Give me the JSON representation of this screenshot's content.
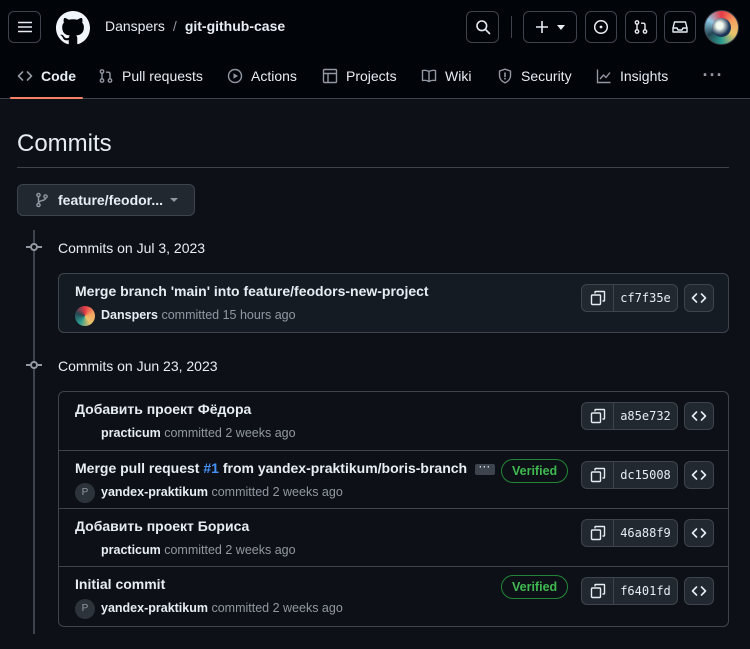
{
  "header": {
    "owner": "Danspers",
    "separator": "/",
    "repo": "git-github-case"
  },
  "nav": {
    "tabs": [
      {
        "label": "Code",
        "icon": "code-icon",
        "active": true
      },
      {
        "label": "Pull requests",
        "icon": "git-pull-request-icon"
      },
      {
        "label": "Actions",
        "icon": "play-icon"
      },
      {
        "label": "Projects",
        "icon": "table-icon"
      },
      {
        "label": "Wiki",
        "icon": "book-icon"
      },
      {
        "label": "Security",
        "icon": "shield-icon"
      },
      {
        "label": "Insights",
        "icon": "graph-icon"
      }
    ],
    "more": "···"
  },
  "page": {
    "title": "Commits",
    "branch": "feature/feodor..."
  },
  "groups": [
    {
      "title": "Commits on Jul 3, 2023",
      "commits": [
        {
          "title": "Merge branch 'main' into feature/feodors-new-project",
          "author": "Danspers",
          "time": "committed 15 hours ago",
          "sha": "cf7f35e",
          "avatar": "color"
        }
      ]
    },
    {
      "title": "Commits on Jun 23, 2023",
      "commits": [
        {
          "title": "Добавить проект Фёдора",
          "author": "practicum",
          "time": "committed 2 weeks ago",
          "sha": "a85e732",
          "avatar": "none"
        },
        {
          "title_pre": "Merge pull request ",
          "issue": "#1",
          "title_post": " from yandex-praktikum/boris-branch",
          "author": "yandex-praktikum",
          "time": "committed 2 weeks ago",
          "sha": "dc15008",
          "verified": "Verified",
          "avatar": "letter",
          "avatar_letter": "P"
        },
        {
          "title": "Добавить проект Бориса",
          "author": "practicum",
          "time": "committed 2 weeks ago",
          "sha": "46a88f9",
          "avatar": "none"
        },
        {
          "title": "Initial commit",
          "author": "yandex-praktikum",
          "time": "committed 2 weeks ago",
          "sha": "f6401fd",
          "verified": "Verified",
          "avatar": "letter",
          "avatar_letter": "P"
        }
      ]
    }
  ],
  "colors": {
    "accent_underline": "#f78166",
    "link": "#4493f8",
    "verified": "#3fb950",
    "background": "#0d1117"
  }
}
